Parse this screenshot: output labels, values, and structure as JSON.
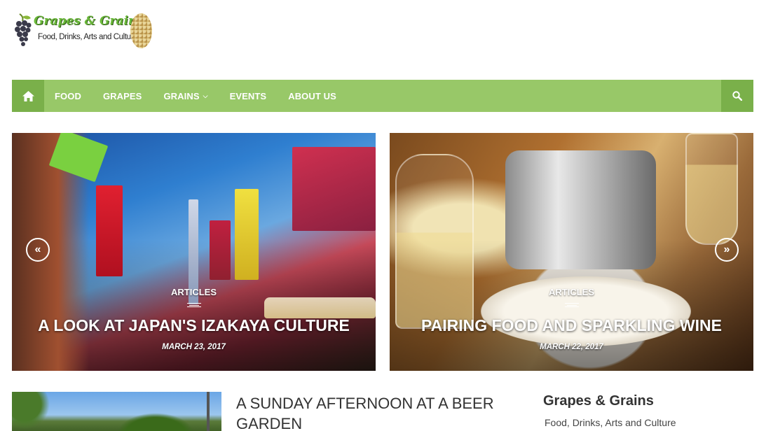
{
  "logo": {
    "title": "Grapes & Grains",
    "subtitle": "Food, Drinks, Arts and Culture"
  },
  "nav": {
    "home_icon": "home-icon",
    "items": [
      {
        "label": "FOOD"
      },
      {
        "label": "GRAPES"
      },
      {
        "label": "GRAINS"
      },
      {
        "label": "EVENTS"
      },
      {
        "label": "ABOUT US"
      }
    ],
    "search_icon": "search-icon",
    "background": "#98c868",
    "accent": "#7ab04a"
  },
  "slider": {
    "prev_icon": "double-chevron-left-icon",
    "next_icon": "double-chevron-right-icon",
    "prev_glyph": "«",
    "next_glyph": "»",
    "slides": [
      {
        "category": "ARTICLES",
        "title": "A LOOK AT JAPAN'S IZAKAYA CULTURE",
        "date": "MARCH 23, 2017"
      },
      {
        "category": "ARTICLES",
        "title": "PAIRING FOOD AND SPARKLING WINE",
        "date": "MARCH 22, 2017"
      }
    ]
  },
  "posts": [
    {
      "title": "A SUNDAY AFTERNOON AT A BEER GARDEN"
    }
  ],
  "sidebar": {
    "title": "Grapes & Grains",
    "subtitle": "Food, Drinks, Arts and Culture"
  }
}
